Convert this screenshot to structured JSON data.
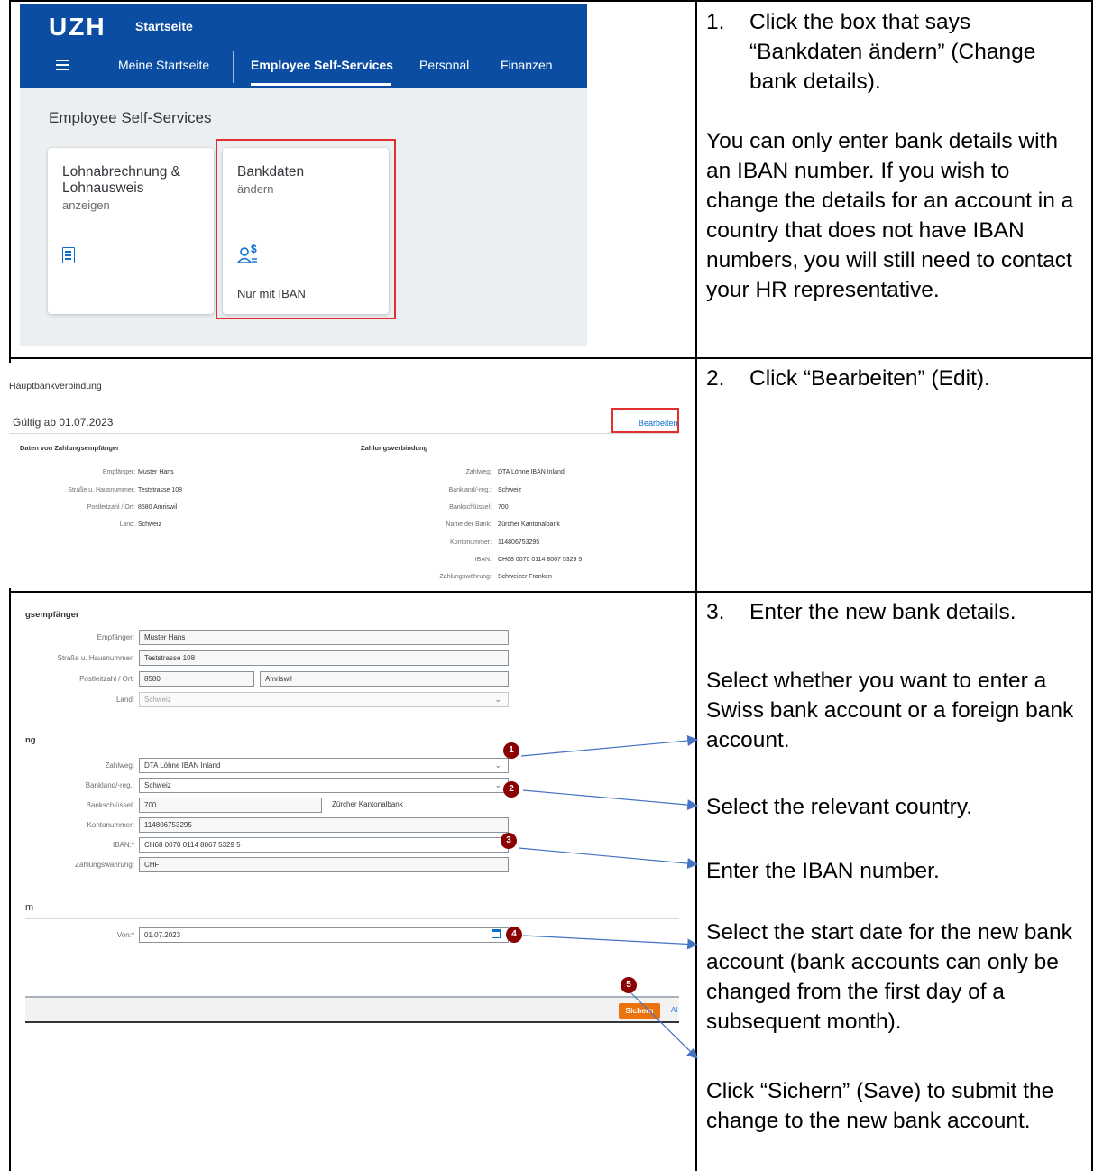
{
  "step1": {
    "number": "1.",
    "text": "Click the box that says “Bankdaten ändern” (Change bank details).",
    "note": "You can only enter bank details with an IBAN number. If you wish to change the details for an account in a country that does not have IBAN numbers, you will still need to contact your HR representative."
  },
  "step2": {
    "number": "2.",
    "text": "Click “Bearbeiten” (Edit)."
  },
  "step3": {
    "number": "3.",
    "text": "Enter the new bank details.",
    "select_account": "Select whether you want to enter a Swiss bank account or a foreign bank account.",
    "select_country": "Select the relevant country.",
    "enter_iban": "Enter the IBAN number.",
    "select_date": "Select the start date for the new bank account (bank accounts can only be changed from the first day of a subsequent month).",
    "click_save": "Click “Sichern” (Save) to submit the change to the new bank account."
  },
  "screenshot1": {
    "logo": "UZH",
    "title": "Startseite",
    "nav": [
      "Meine Startseite",
      "Employee Self-Services",
      "Personal",
      "Finanzen"
    ],
    "section_title": "Employee Self-Services",
    "tile1": {
      "title": "Lohnabrechnung & Lohnausweis",
      "subtitle": "anzeigen",
      "icon": "list-document-icon"
    },
    "tile2": {
      "title": "Bankdaten",
      "subtitle": "ändern",
      "icon": "person-dollar-icon",
      "footer": "Nur mit IBAN"
    },
    "colors": {
      "shell": "#0b4da2",
      "highlight": "#e03030"
    }
  },
  "screenshot2": {
    "heading": "Hauptbankverbindung",
    "valid_from": "Gültig ab 01.07.2023",
    "edit": "Bearbeiten",
    "left_group": "Daten von Zahlungsempfänger",
    "right_group": "Zahlungsverbindung",
    "left_rows": [
      {
        "label": "Empfänger:",
        "value": "Muster Hans"
      },
      {
        "label": "Straße u. Hausnummer:",
        "value": "Teststrasse 108"
      },
      {
        "label": "Postleitzahl / Ort:",
        "value": "8580 Amriswil"
      },
      {
        "label": "Land:",
        "value": "Schweiz"
      }
    ],
    "right_rows": [
      {
        "label": "Zahlweg:",
        "value": "DTA Löhne IBAN Inland"
      },
      {
        "label": "Bankland/-reg.:",
        "value": "Schweiz"
      },
      {
        "label": "Bankschlüssel:",
        "value": "700"
      },
      {
        "label": "Name der Bank:",
        "value": "Zürcher Kantonalbank"
      },
      {
        "label": "Kontonummer:",
        "value": "114806753295"
      },
      {
        "label": "IBAN:",
        "value": "CH68 0070 0114 8067 5329 5"
      },
      {
        "label": "Zahlungswährung:",
        "value": "Schweizer Franken"
      }
    ]
  },
  "screenshot3": {
    "group1": "gsempfänger",
    "group2": "ng",
    "group3": "m",
    "empfaenger_label": "Empfänger:",
    "empfaenger": "Muster Hans",
    "strasse_label": "Straße u. Hausnummer:",
    "strasse": "Teststrasse 108",
    "plz_label": "Postleitzahl / Ort:",
    "plz": "8580",
    "ort": "Amriswil",
    "land_label": "Land:",
    "land": "Schweiz",
    "zahlweg_label": "Zahlweg:",
    "zahlweg": "DTA Löhne IBAN Inland",
    "bankland_label": "Bankland/-reg.:",
    "bankland": "Schweiz",
    "bankschluessel_label": "Bankschlüssel:",
    "bankschluessel": "700",
    "bank_name": "Zürcher Kantonalbank",
    "konto_label": "Kontonummer:",
    "konto": "114806753295",
    "iban_label": "IBAN:",
    "iban": "CH68 0070 0114 8067 5329 5",
    "waehrung_label": "Zahlungswährung:",
    "waehrung": "CHF",
    "von_label": "Von:",
    "required_mark": "*",
    "von": "01.07.2023",
    "save": "Sichern",
    "cancel_stub": "Al",
    "markers": [
      "1",
      "2",
      "3",
      "4",
      "5"
    ],
    "colors": {
      "marker": "#8b0000",
      "arrow": "#4472c4",
      "save": "#e9730c"
    }
  }
}
